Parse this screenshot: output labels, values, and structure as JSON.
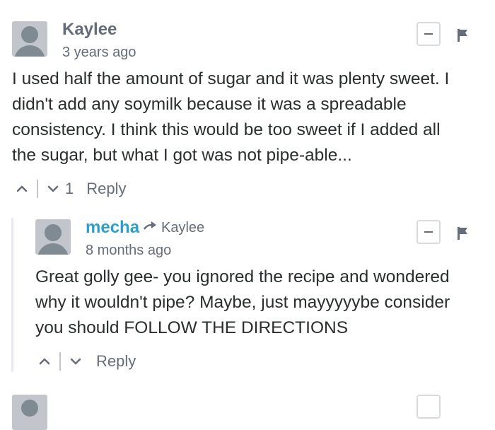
{
  "comments": [
    {
      "author": "Kaylee",
      "time": "3 years ago",
      "body": "I used half the amount of sugar and it was plenty sweet. I didn't add any soymilk because it was a spreadable consistency. I think this would be too sweet if I added all the sugar, but what I got was not pipe-able...",
      "body_lines": [
        "I used half the amount of sugar and it was plenty sweet. I",
        "didn't add any soymilk because it was a spreadable",
        "consistency. I think this would be too sweet if I added all",
        "the sugar, but what I got was not pipe-able..."
      ],
      "votes": "1",
      "reply_label": "Reply"
    },
    {
      "author": "mecha",
      "reply_to": "Kaylee",
      "time": "8 months ago",
      "body_lines": [
        "Great golly gee- you ignored the recipe and wondered",
        "why it wouldn't pipe? Maybe, just mayyyyybe consider",
        "you should FOLLOW THE DIRECTIONS"
      ],
      "votes": "",
      "reply_label": "Reply"
    }
  ],
  "icons": {
    "collapse": "minus-icon",
    "flag": "flag-icon",
    "upvote": "chevron-up-icon",
    "downvote": "chevron-down-icon",
    "reply_arrow": "arrow-right-icon"
  },
  "colors": {
    "link": "#2e9fcb",
    "muted": "#656c7a",
    "text": "#2a2e2e",
    "avatar_bg": "#c2c6cc",
    "avatar_fg": "#7f8a93"
  }
}
